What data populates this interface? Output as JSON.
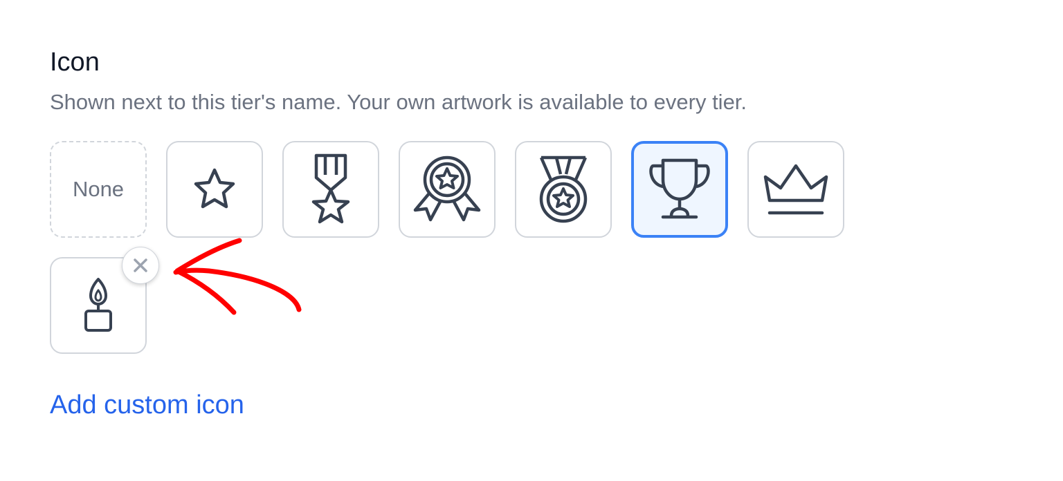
{
  "section": {
    "title": "Icon",
    "subtitle": "Shown next to this tier's name. Your own artwork is available to every tier."
  },
  "tiles": [
    {
      "id": "none",
      "label": "None",
      "selected": false
    },
    {
      "id": "star",
      "icon": "star-icon",
      "selected": false
    },
    {
      "id": "medal-ribbon",
      "icon": "medal-ribbon-icon",
      "selected": false
    },
    {
      "id": "rosette",
      "icon": "award-rosette-icon",
      "selected": false
    },
    {
      "id": "medal",
      "icon": "medal-icon",
      "selected": false
    },
    {
      "id": "trophy",
      "icon": "trophy-icon",
      "selected": true
    },
    {
      "id": "crown",
      "icon": "crown-icon",
      "selected": false
    }
  ],
  "custom_tiles": [
    {
      "id": "candle",
      "icon": "candle-icon",
      "removable": true
    }
  ],
  "actions": {
    "add_custom_label": "Add custom icon"
  },
  "colors": {
    "icon_stroke": "#374151",
    "selected_border": "#3b82f6",
    "selected_bg": "#eff6ff",
    "link": "#2563eb",
    "annotation": "#ff0000"
  }
}
